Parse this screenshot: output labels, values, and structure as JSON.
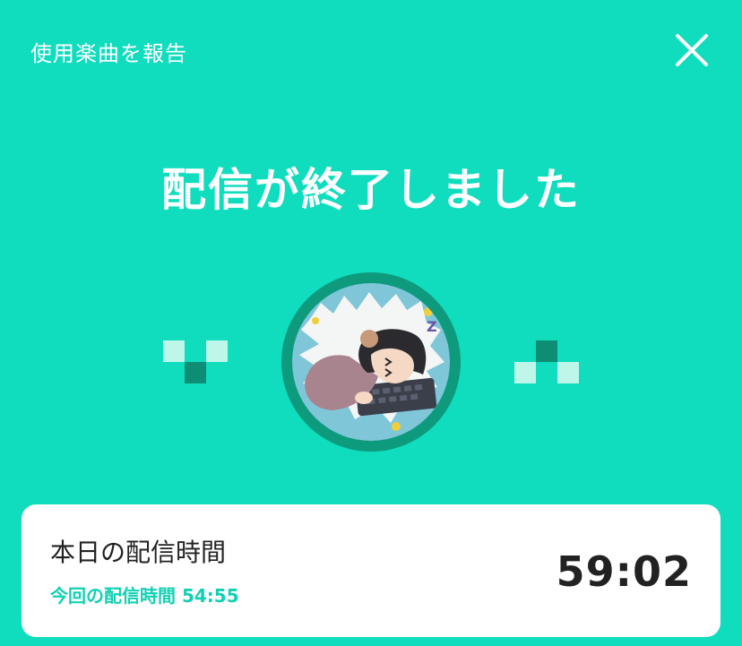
{
  "header": {
    "report_label": "使用楽曲を報告",
    "close_icon": "close-icon"
  },
  "main": {
    "title": "配信が終了しました",
    "avatar_icon": "sleeping-girl-avatar"
  },
  "stats": {
    "today_label": "本日の配信時間",
    "today_value": "59:02",
    "this_stream_label": "今回の配信時間",
    "this_stream_value": "54:55"
  },
  "colors": {
    "background": "#10dcbe",
    "accent": "#12d0b4",
    "pixel_light": "#bff6ea",
    "pixel_dark": "#0c8d74",
    "ring": "#0e9b7d"
  }
}
